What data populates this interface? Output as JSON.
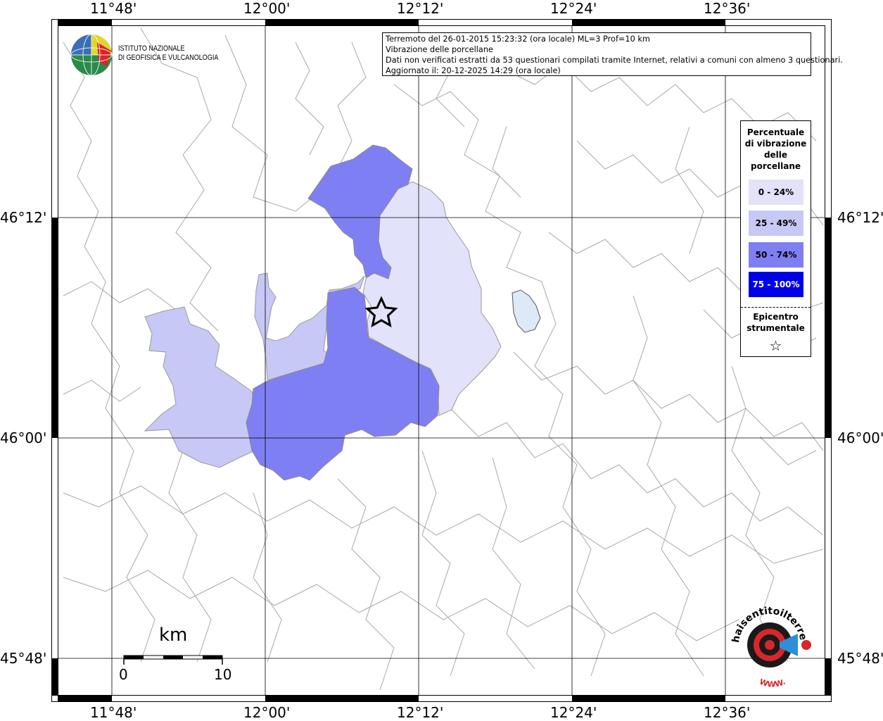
{
  "header": {
    "line1": "Terremoto del 26-01-2015 15:23:32 (ora locale) ML=3 Prof=10 km",
    "line2": "Vibrazione delle porcellane",
    "line3": "Dati non verificati estratti da 53 questionari compilati tramite Internet, relativi a comuni con almeno 3 questionari.",
    "line4": "Aggiornato il: 20-12-2025 14:29 (ora locale)"
  },
  "institute": {
    "line1": "ISTITUTO NAZIONALE",
    "line2": "DI GEOFISICA E VULCANOLOGIA"
  },
  "axes": {
    "top": [
      "11°48'",
      "12°00'",
      "12°12'",
      "12°24'",
      "12°36'"
    ],
    "bottom": [
      "11°48'",
      "12°00'",
      "12°12'",
      "12°24'",
      "12°36'"
    ],
    "left": [
      "46°12'",
      "46°00'",
      "45°48'"
    ],
    "right": [
      "46°12'",
      "46°00'",
      "45°48'"
    ]
  },
  "legend": {
    "title_lines": [
      "Percentuale",
      "di vibrazione",
      "delle",
      "porcellane"
    ],
    "classes": [
      {
        "label": "0 - 24%",
        "color": "#e2e2fa",
        "text_color": "#000000"
      },
      {
        "label": "25 - 49%",
        "color": "#c8c8f6",
        "text_color": "#000000"
      },
      {
        "label": "50 - 74%",
        "color": "#7f7ff4",
        "text_color": "#000000"
      },
      {
        "label": "75 - 100%",
        "color": "#0000e8",
        "text_color": "#ffffff"
      }
    ],
    "epicenter_lines": [
      "Epicentro",
      "strumentale"
    ],
    "epicenter_symbol": "☆"
  },
  "scale_bar": {
    "unit": "km",
    "start": "0",
    "end": "10"
  },
  "brand": {
    "text": "haisentitoilterremoto.it",
    "url_text": "WWW.",
    "icon": "speaker-target-icon"
  },
  "colors": {
    "boundary": "#a8a8a8",
    "grid": "#000000",
    "lake": "#dde9f7"
  }
}
